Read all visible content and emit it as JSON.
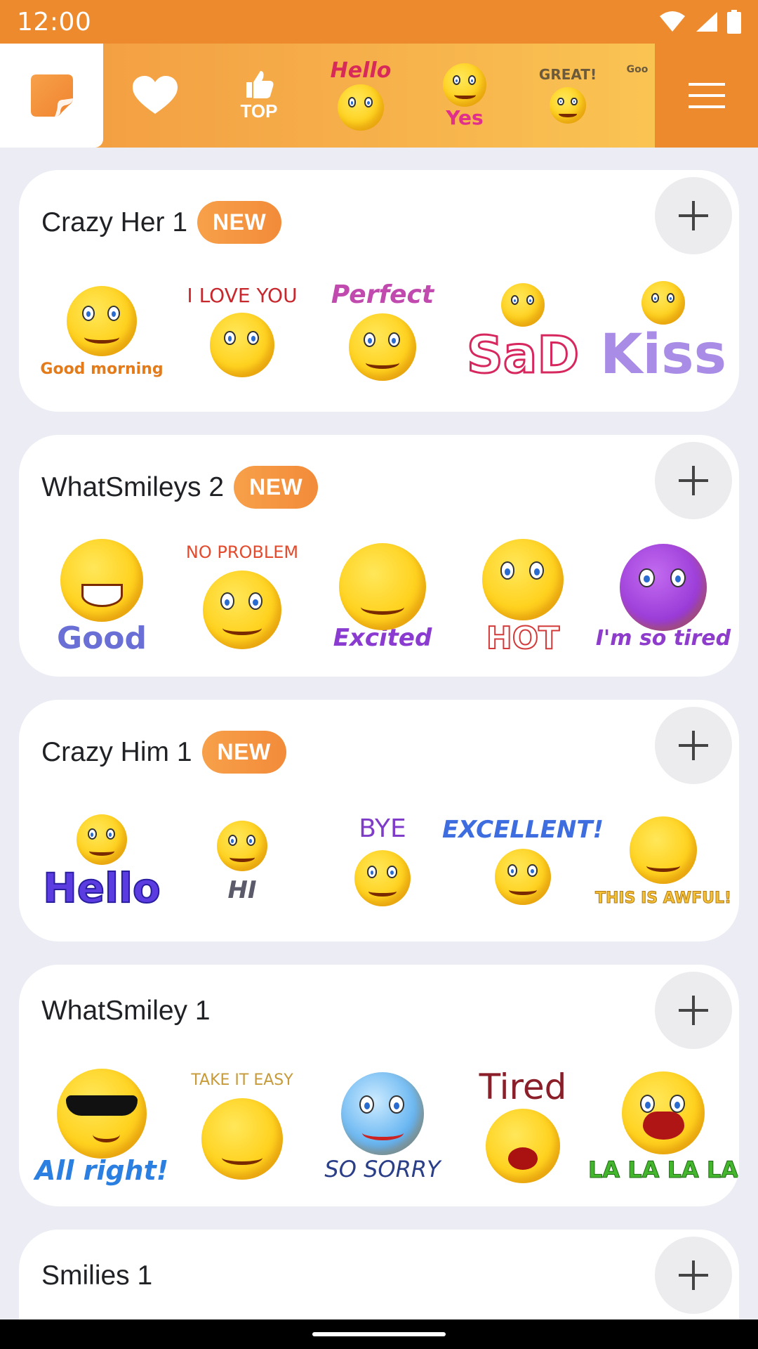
{
  "status": {
    "time": "12:00"
  },
  "topbar": {
    "top_label": "TOP",
    "hello_label": "Hello",
    "yes_label": "Yes",
    "great_label": "GREAT!",
    "goo_label": "Goo"
  },
  "cards": [
    {
      "title": "Crazy Her 1",
      "badge": "NEW",
      "stickers": [
        {
          "caption": "Good morning"
        },
        {
          "caption": "I LOVE YOU"
        },
        {
          "caption": "Perfect"
        },
        {
          "caption": "SaD"
        },
        {
          "caption": "Kiss"
        }
      ]
    },
    {
      "title": "WhatSmileys 2",
      "badge": "NEW",
      "stickers": [
        {
          "caption": "Good"
        },
        {
          "caption": "NO PROBLEM"
        },
        {
          "caption": "Excited"
        },
        {
          "caption": "HOT"
        },
        {
          "caption": "I'm so tired"
        }
      ]
    },
    {
      "title": "Crazy Him 1",
      "badge": "NEW",
      "stickers": [
        {
          "caption": "Hello"
        },
        {
          "caption": "HI"
        },
        {
          "caption": "BYE"
        },
        {
          "caption": "EXCELLENT!"
        },
        {
          "caption": "THIS IS AWFUL!"
        }
      ]
    },
    {
      "title": "WhatSmiley 1",
      "badge": "",
      "stickers": [
        {
          "caption": "All right!"
        },
        {
          "caption": "TAKE IT EASY"
        },
        {
          "caption": "SO SORRY"
        },
        {
          "caption": "Tired"
        },
        {
          "caption": "LA LA LA LA"
        }
      ]
    },
    {
      "title": "Smilies 1",
      "badge": ""
    }
  ],
  "colors": {
    "accent": "#EE8A2E",
    "badge": "#F28B3A",
    "background": "#ECEDF4"
  }
}
